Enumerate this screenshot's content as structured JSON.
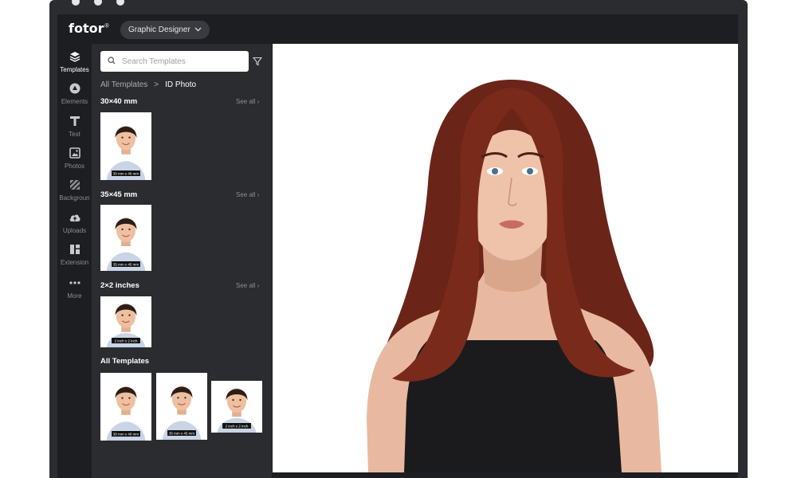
{
  "window": {
    "dots": 3
  },
  "brand": {
    "logo": "fotor",
    "reg": "®"
  },
  "topbar": {
    "role_label": "Graphic Designer"
  },
  "rail": [
    {
      "label": "Templates",
      "icon": "layers-icon",
      "active": true
    },
    {
      "label": "Elements",
      "icon": "shapes-icon"
    },
    {
      "label": "Text",
      "icon": "text-icon"
    },
    {
      "label": "Photos",
      "icon": "image-icon"
    },
    {
      "label": "Backgroun",
      "icon": "pattern-icon"
    },
    {
      "label": "Uploads",
      "icon": "cloud-upload-icon"
    },
    {
      "label": "Extension",
      "icon": "extension-icon"
    },
    {
      "label": "More",
      "icon": "more-dots-icon"
    }
  ],
  "panel": {
    "search_placeholder": "Search Templates",
    "breadcrumb": {
      "root": "All Templates",
      "sep": ">",
      "current": "ID Photo"
    },
    "see_all": "See all",
    "sections": [
      {
        "title": "30×40 mm",
        "captions": [
          "30 mm x 40 mm"
        ]
      },
      {
        "title": "35×45 mm",
        "captions": [
          "35 mm x 45 mm"
        ]
      },
      {
        "title": "2×2 inches",
        "captions": [
          "2 inch x 2 inch"
        ]
      },
      {
        "title": "All Templates",
        "captions": [
          "30 mm x 40 mm",
          "35 mm x 45 mm",
          "2 inch x 2 inch"
        ]
      }
    ]
  },
  "colors": {
    "frame": "#2b2c30",
    "app_bg": "#1d1e22",
    "panel_bg": "#2b2c30",
    "hair": "#6b2418",
    "skin": "#e8b9a0",
    "top": "#1b1b1d"
  }
}
